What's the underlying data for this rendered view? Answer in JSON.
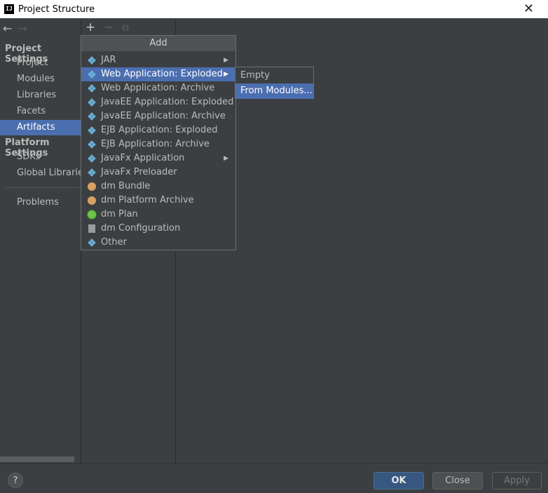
{
  "window": {
    "title": "Project Structure",
    "app_icon_text": "IJ",
    "close_glyph": "✕"
  },
  "nav": {
    "back_glyph": "←",
    "forward_glyph": "→"
  },
  "sidebar": {
    "project_settings_title": "Project Settings",
    "project_items": [
      "Project",
      "Modules",
      "Libraries",
      "Facets",
      "Artifacts"
    ],
    "selected": "Artifacts",
    "platform_settings_title": "Platform Settings",
    "platform_items": [
      "SDKs",
      "Global Libraries"
    ],
    "other_items": [
      "Problems"
    ]
  },
  "toolbar": {
    "add_glyph": "+",
    "remove_glyph": "−",
    "copy_glyph": "⧉"
  },
  "add_menu": {
    "title": "Add",
    "items": [
      {
        "label": "JAR",
        "icon": "diamond-icon",
        "submenu": true
      },
      {
        "label": "Web Application: Exploded",
        "icon": "web-exploded-icon",
        "submenu": true,
        "highlighted": true
      },
      {
        "label": "Web Application: Archive",
        "icon": "web-archive-icon"
      },
      {
        "label": "JavaEE Application: Exploded",
        "icon": "javaee-exploded-icon"
      },
      {
        "label": "JavaEE Application: Archive",
        "icon": "javaee-archive-icon"
      },
      {
        "label": "EJB Application: Exploded",
        "icon": "ejb-exploded-icon"
      },
      {
        "label": "EJB Application: Archive",
        "icon": "ejb-archive-icon"
      },
      {
        "label": "JavaFx Application",
        "icon": "javafx-icon",
        "submenu": true
      },
      {
        "label": "JavaFx Preloader",
        "icon": "javafx-preloader-icon"
      },
      {
        "label": "dm Bundle",
        "icon": "dm-bundle-icon"
      },
      {
        "label": "dm Platform Archive",
        "icon": "dm-platform-archive-icon"
      },
      {
        "label": "dm Plan",
        "icon": "dm-plan-icon"
      },
      {
        "label": "dm Configuration",
        "icon": "dm-configuration-icon"
      },
      {
        "label": "Other",
        "icon": "other-icon"
      }
    ],
    "submenu_arrow": "▶"
  },
  "submenu": {
    "items": [
      "Empty",
      "From Modules..."
    ],
    "highlighted": "From Modules..."
  },
  "footer": {
    "help_label": "?",
    "ok_label": "OK",
    "close_label": "Close",
    "apply_label": "Apply"
  },
  "colors": {
    "background": "#3c3f41",
    "selection": "#4b6eaf",
    "ok_button": "#365880"
  }
}
